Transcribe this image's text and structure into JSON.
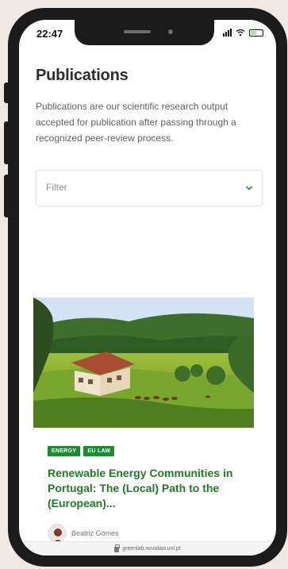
{
  "status_bar": {
    "time": "22:47"
  },
  "page": {
    "title": "Publications",
    "description": "Publications are our scientific research output accepted for publication after passing through a recognized peer-review process."
  },
  "filter": {
    "value": "Filter",
    "icon": "chevron-down-icon",
    "accent": "#2e8b3d"
  },
  "card": {
    "tags": [
      "ENERGY",
      "EU LAW"
    ],
    "title": "Renewable Energy Communities in Portugal: The (Local) Path to the (European)...",
    "author": "Beatriz Gomes",
    "image_description": "green countryside with farmhouse",
    "title_color": "#1f7a27",
    "tag_color": "#1e8a32"
  },
  "browser": {
    "url": "greenlab.novalaw.unl.pt"
  },
  "icons": {
    "signal": "signal-icon",
    "wifi": "wifi-icon",
    "battery": "battery-icon",
    "lock": "lock-icon"
  }
}
